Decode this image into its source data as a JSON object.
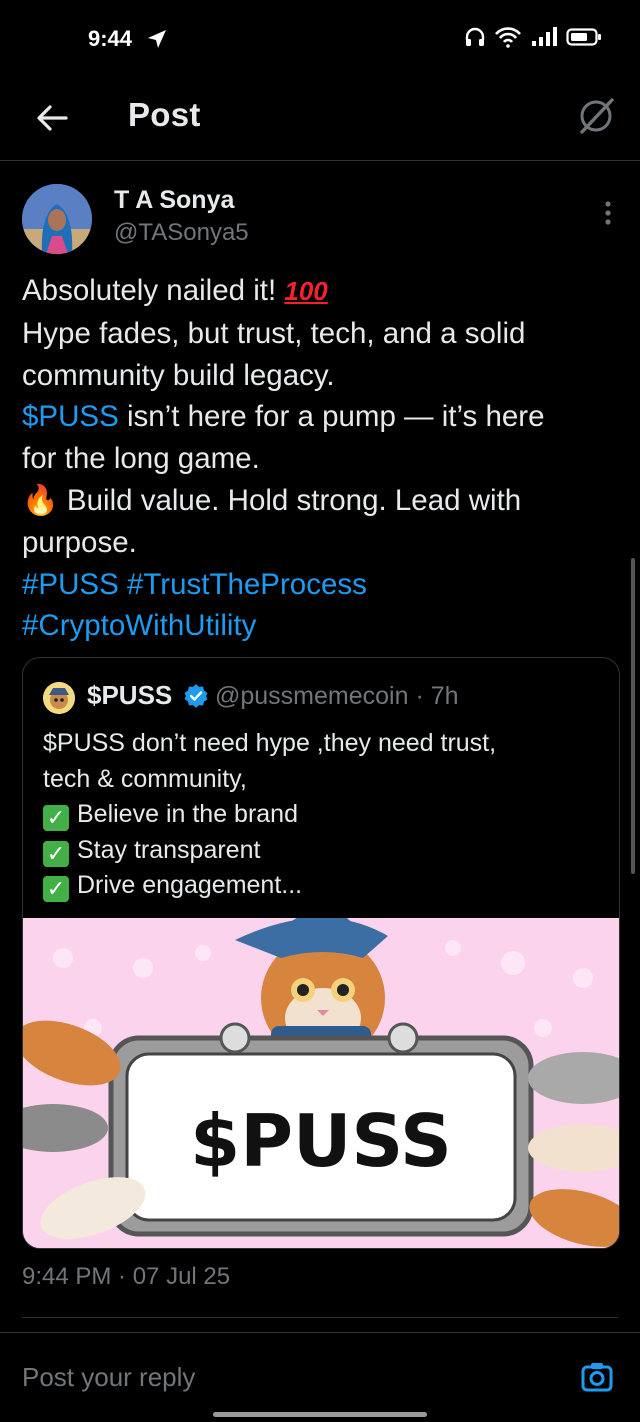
{
  "status_bar": {
    "time": "9:44"
  },
  "header": {
    "title": "Post"
  },
  "author": {
    "name": "T A Sonya",
    "handle": "@TASonya5"
  },
  "tweet": {
    "line1": "Absolutely nailed it! ",
    "emoji_100": "100",
    "line2": "Hype fades, but trust, tech, and a solid",
    "line3": "community build legacy.",
    "line4_link": "$PUSS",
    "line4_rest": " isn’t here for a pump — it’s here",
    "line5": "for the long game.",
    "line6_emoji": "🔥",
    "line6": " Build value. Hold strong. Lead with",
    "line7": "purpose.",
    "hashtag1": "#PUSS",
    "hashtag2": "#TrustTheProcess",
    "hashtag3": "#CryptoWithUtility"
  },
  "quote": {
    "name": "$PUSS",
    "handle_time": "@pussmemecoin · 7h",
    "line1": "$PUSS don’t need hype ,they need trust,",
    "line2": "tech & community,",
    "check1": "Believe in the brand",
    "check2": "Stay transparent",
    "check3": "Drive engagement...",
    "image_sign_text": "$PUSS"
  },
  "timestamp": "9:44 PM · 07 Jul 25",
  "reply": {
    "placeholder": "Post your reply"
  },
  "colors": {
    "accent": "#1d9bf0",
    "background": "#000000",
    "muted": "#71767b"
  },
  "icons": [
    "back-arrow-icon",
    "grok-icon",
    "more-vertical-icon",
    "verified-badge-icon",
    "camera-icon"
  ]
}
